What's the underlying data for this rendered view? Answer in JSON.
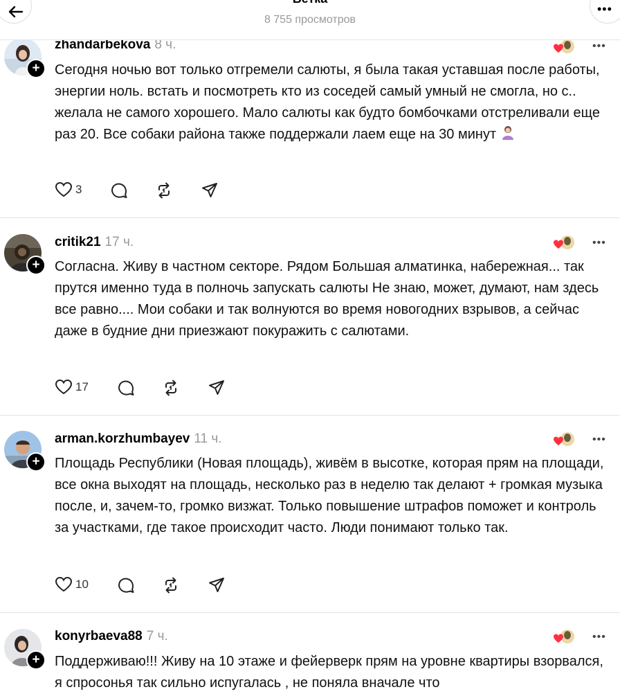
{
  "header": {
    "title": "Ветка",
    "subtitle": "8 755 просмотров"
  },
  "posts": [
    {
      "username": "zhandarbekova",
      "time": "8 ч.",
      "text": "Сегодня ночью вот только отгремели салюты, я была такая уставшая после работы, энергии ноль. встать и посмотреть кто из соседей самый умный не смогла, но с.. желала не самого хорошего. Мало салюты как будто бомбочками отстреливали еще раз 20. Все собаки района также поддержали лаем еще на 30 минут",
      "likes": "3"
    },
    {
      "username": "critik21",
      "time": "17 ч.",
      "text": "Согласна. Живу в частном секторе. Рядом Большая алматинка, набережная... так прутся именно туда в полночь запускать салюты Не знаю, может, думают, нам здесь все равно.... Мои собаки и так волнуются во время новогодних взрывов, а сейчас даже в будние дни приезжают покуражить с салютами.",
      "likes": "17"
    },
    {
      "username": "arman.korzhumbayev",
      "time": "11 ч.",
      "text": "Площадь Республики (Новая площадь), живём в высотке, которая прям на площади, все окна выходят на площадь, несколько раз в неделю так делают + громкая музыка после, и, зачем-то, громко визжат. Только повышение штрафов поможет и контроль за участками, где такое происходит часто. Люди понимают только так.",
      "likes": "10"
    },
    {
      "username": "konyrbaeva88",
      "time": "7 ч.",
      "text": "Поддерживаю!!! Живу на 10 этаже и фейерверк прям на уровне квартиры взорвался, я спросонья так сильно испугалась , не поняла вначале что",
      "likes": ""
    }
  ],
  "icons": {
    "back": "arrow-left-icon",
    "more": "more-dots-icon",
    "like": "heart-icon",
    "reply": "comment-icon",
    "repost": "repost-icon",
    "share": "send-icon",
    "liked_by_author": "liked-by-author-badge",
    "follow": "plus-icon"
  },
  "colors": {
    "accent_heart": "#ff3040",
    "muted_text": "#999999",
    "divider": "#e4e4e4"
  }
}
